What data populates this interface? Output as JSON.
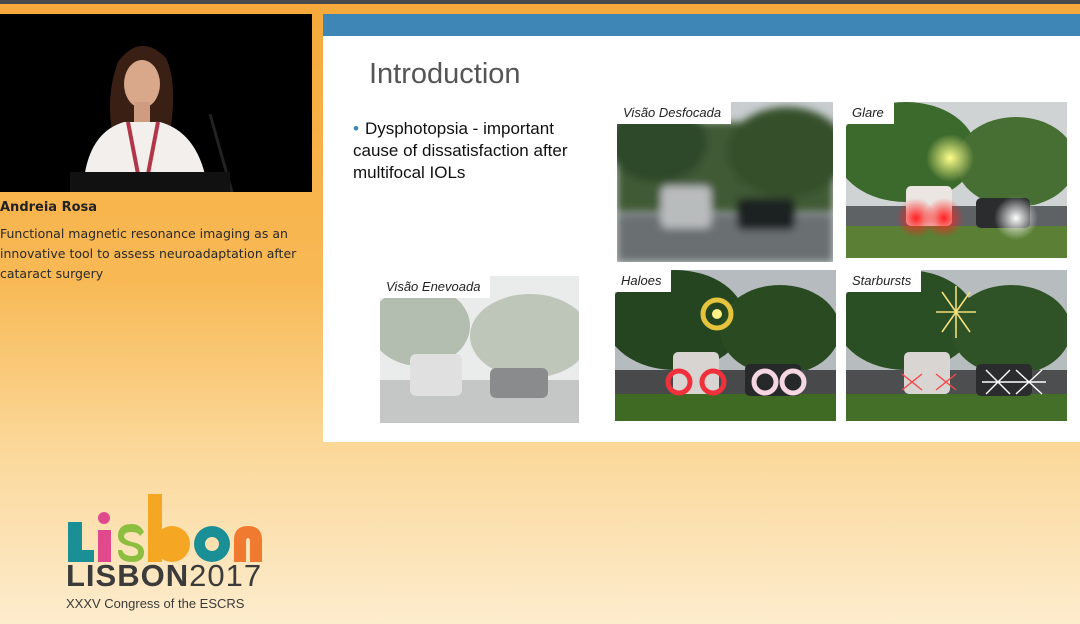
{
  "speaker": {
    "name": "Andreia Rosa",
    "talk_title": "Functional magnetic resonance imaging as an innovative tool to assess neuroadaptation after cataract surgery"
  },
  "slide": {
    "title": "Introduction",
    "bullet": "Dysphotopsia  - important cause of dissatisfaction after multifocal IOLs",
    "images": [
      {
        "caption": "Visão Desfocada"
      },
      {
        "caption": "Glare"
      },
      {
        "caption": "Visão Enevoada"
      },
      {
        "caption": "Haloes"
      },
      {
        "caption": "Starbursts"
      }
    ]
  },
  "logo": {
    "city": "LISBON",
    "year": "2017",
    "subtitle": "XXXV Congress of the ESCRS"
  },
  "colors": {
    "slide_header": "#3d86b5",
    "background_top": "#f6a93a",
    "background_bottom": "#fdeccd"
  }
}
